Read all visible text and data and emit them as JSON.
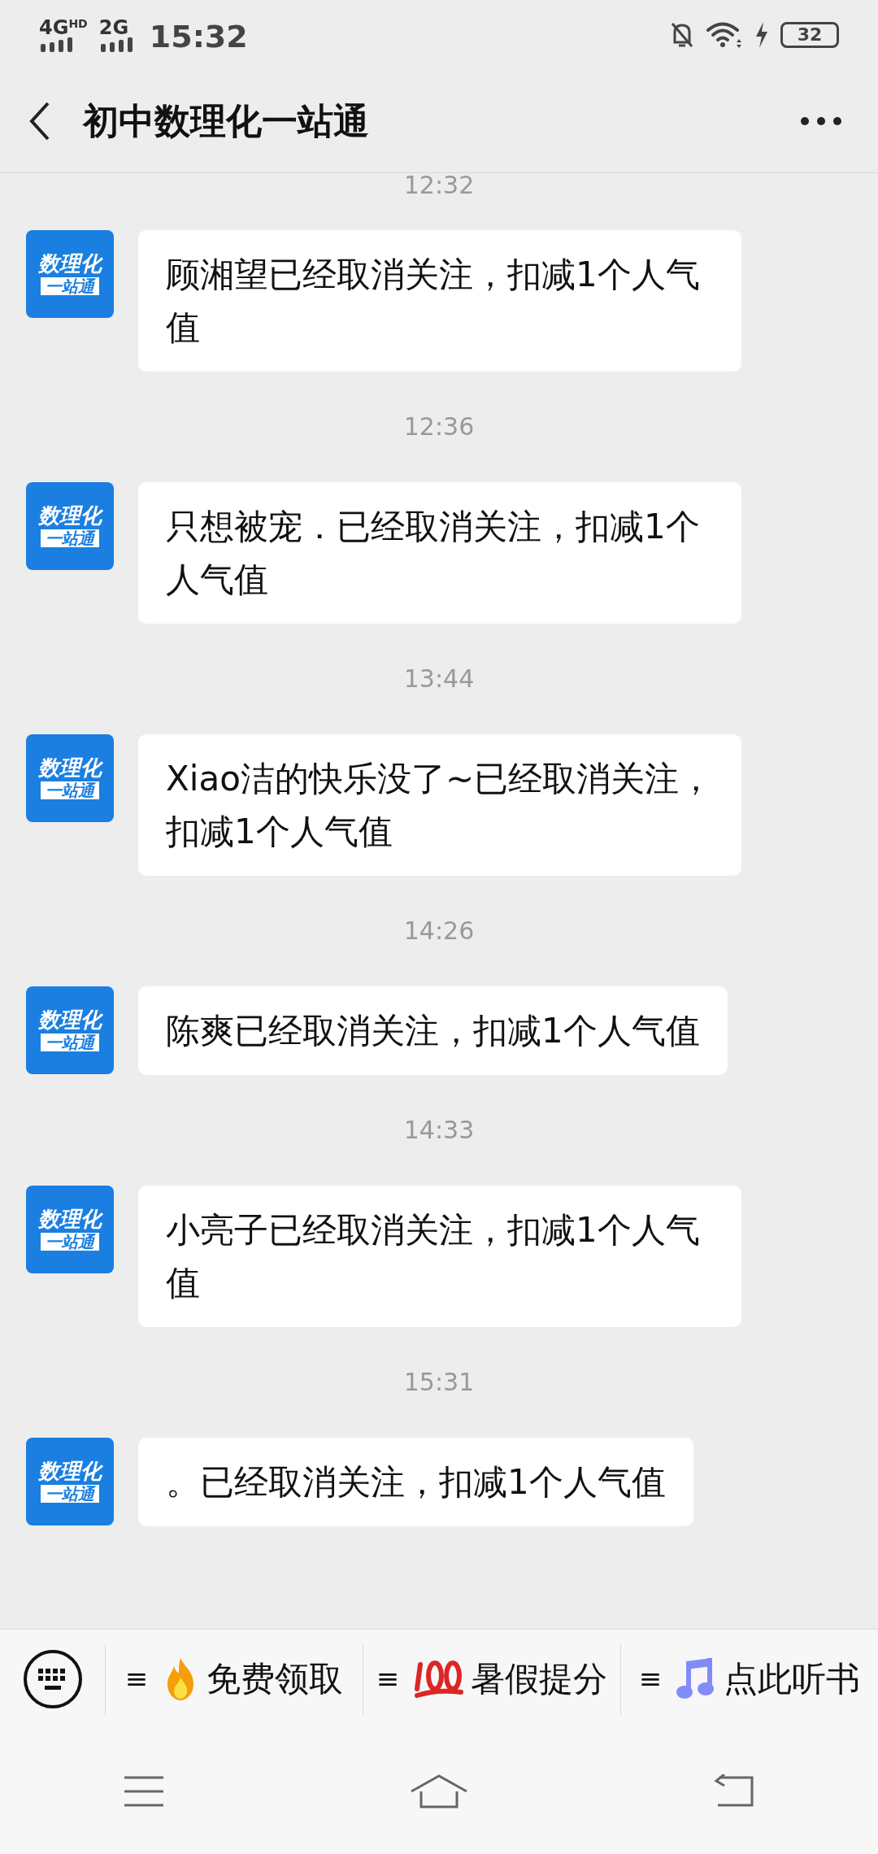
{
  "status_bar": {
    "network_1": "4G",
    "network_1_badge": "HD",
    "network_2": "2G",
    "time": "15:32",
    "battery": "32"
  },
  "header": {
    "title": "初中数理化一站通"
  },
  "messages": [
    {
      "time": "12:32",
      "avatar_top": "数理化",
      "avatar_bottom": "一站通",
      "text": "顾湘望已经取消关注，扣减1个人气值"
    },
    {
      "time": "12:36",
      "avatar_top": "数理化",
      "avatar_bottom": "一站通",
      "text": "只想被宠．已经取消关注，扣减1个人气值"
    },
    {
      "time": "13:44",
      "avatar_top": "数理化",
      "avatar_bottom": "一站通",
      "text": "Xiao洁的快乐没了~已经取消关注，扣减1个人气值"
    },
    {
      "time": "14:26",
      "avatar_top": "数理化",
      "avatar_bottom": "一站通",
      "text": "陈爽已经取消关注，扣减1个人气值"
    },
    {
      "time": "14:33",
      "avatar_top": "数理化",
      "avatar_bottom": "一站通",
      "text": "小亮子已经取消关注，扣减1个人气值"
    },
    {
      "time": "15:31",
      "avatar_top": "数理化",
      "avatar_bottom": "一站通",
      "text": "。已经取消关注，扣减1个人气值"
    }
  ],
  "menu": [
    {
      "mark": "≡",
      "kind": "fire",
      "label": "免费领取"
    },
    {
      "mark": "≡",
      "kind": "hundred",
      "label": "暑假提分"
    },
    {
      "mark": "≡",
      "kind": "music",
      "label": "点此听书"
    }
  ]
}
